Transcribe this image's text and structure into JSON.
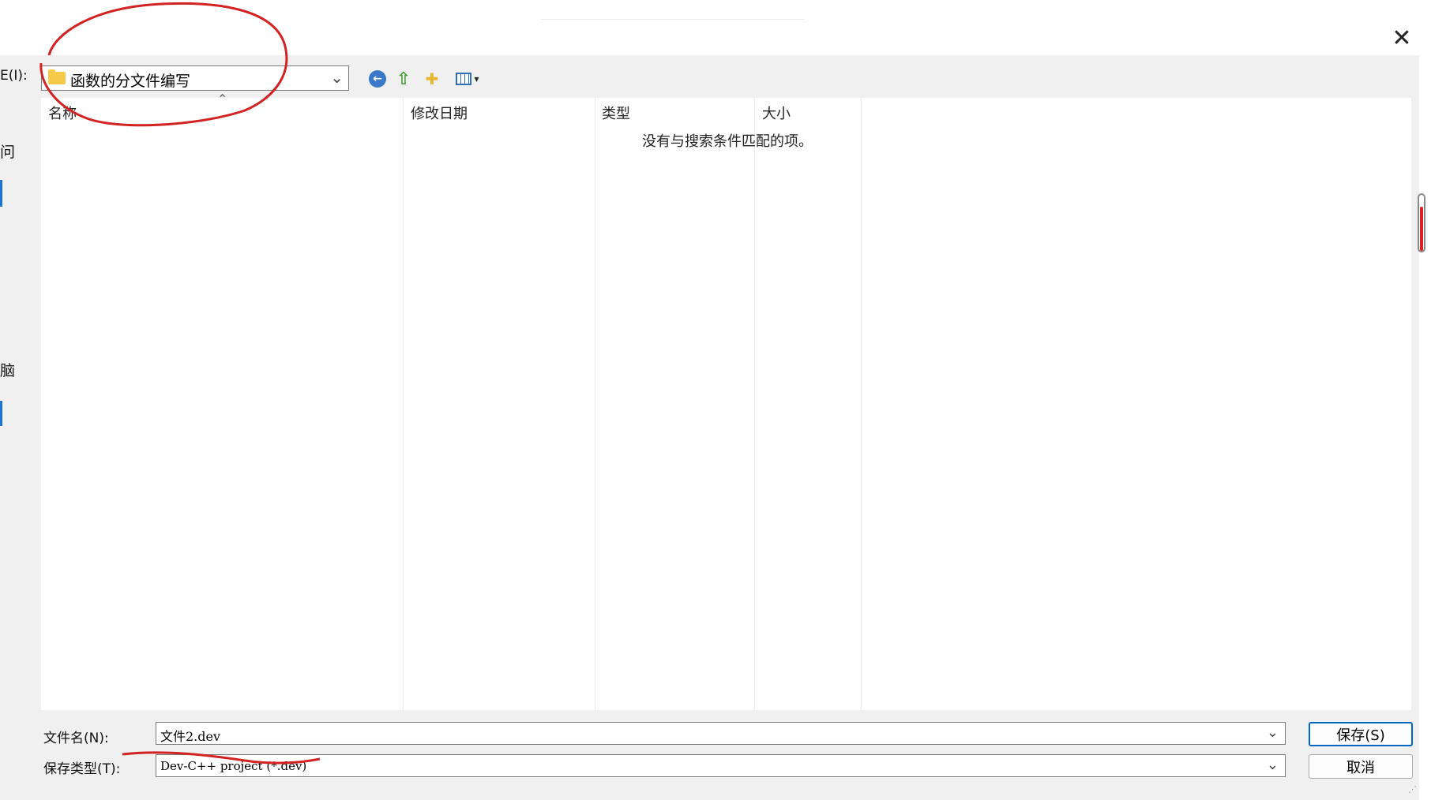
{
  "dialog": {
    "close_glyph": "✕",
    "look_in_label": "E(I):",
    "look_in_value": "函数的分文件编写"
  },
  "toolbar": {
    "back_glyph": "←",
    "up_glyph": "⇧",
    "new_folder_glyph": "✚",
    "view_dropdown_glyph": "▾"
  },
  "places": {
    "fragment_1": "问",
    "fragment_2": "脑"
  },
  "file_list": {
    "columns": [
      "名称",
      "修改日期",
      "类型",
      "大小"
    ],
    "empty_message": "没有与搜索条件匹配的项。"
  },
  "form": {
    "filename_label": "文件名(N):",
    "filename_value": "文件2.dev",
    "filetype_label": "保存类型(T):",
    "filetype_value": "Dev-C++ project (*.dev)",
    "save_button": "保存(S)",
    "cancel_button": "取消"
  },
  "icons": {
    "folder": "folder-icon",
    "back": "back-arrow-icon",
    "up": "up-folder-icon",
    "new_folder": "new-folder-icon",
    "view": "view-menu-icon",
    "close": "close-icon",
    "dropdown": "chevron-down-icon"
  },
  "colors": {
    "accent": "#0067c0",
    "annotation": "#d22222",
    "folder": "#f7c948"
  }
}
